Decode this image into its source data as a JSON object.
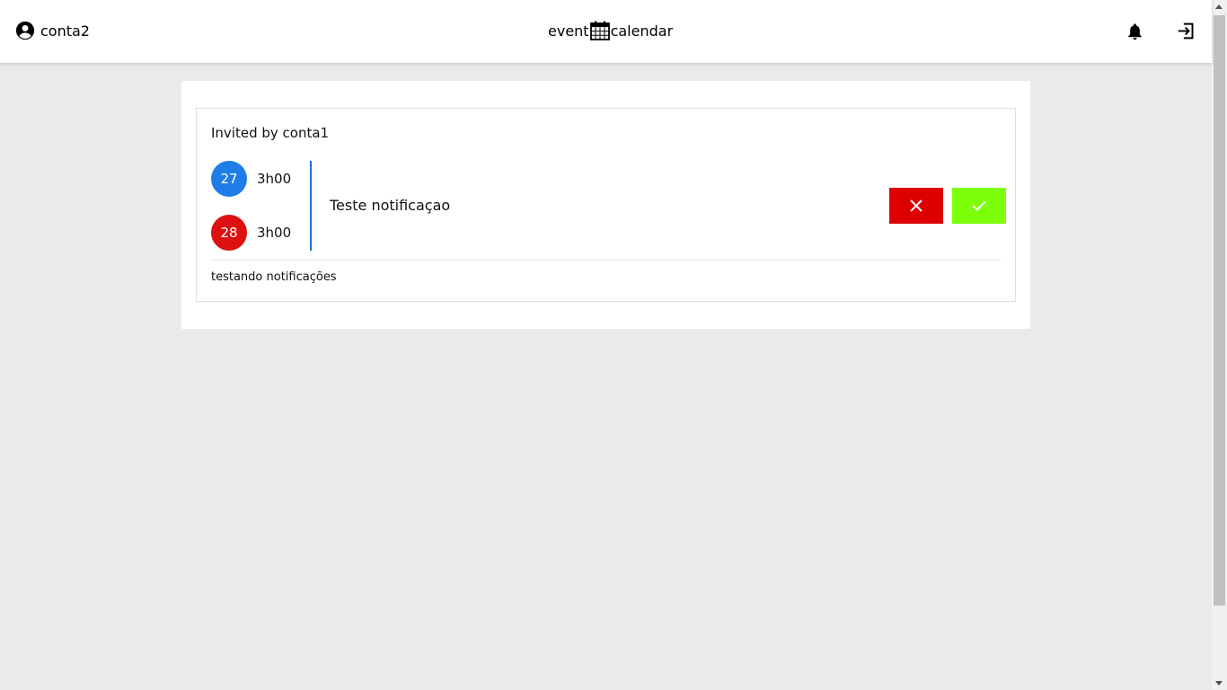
{
  "header": {
    "username": "conta2",
    "logo_left": "event",
    "logo_right": "calendar",
    "icons": {
      "user": "user-circle-icon",
      "calendar": "calendar-icon",
      "bell": "bell-icon",
      "logout": "logout-icon"
    }
  },
  "invite": {
    "invited_by": "Invited by conta1",
    "start": {
      "day": "27",
      "time": "3h00"
    },
    "end": {
      "day": "28",
      "time": "3h00"
    },
    "title": "Teste notificaçao",
    "description": "testando notificações",
    "reject_icon": "close-icon",
    "accept_icon": "check-icon"
  },
  "colors": {
    "start_day": "#1e7de6",
    "end_day": "#dd1111",
    "reject": "#dd0000",
    "accept": "#7dff0c",
    "divider_accent": "#1d6fc8"
  }
}
